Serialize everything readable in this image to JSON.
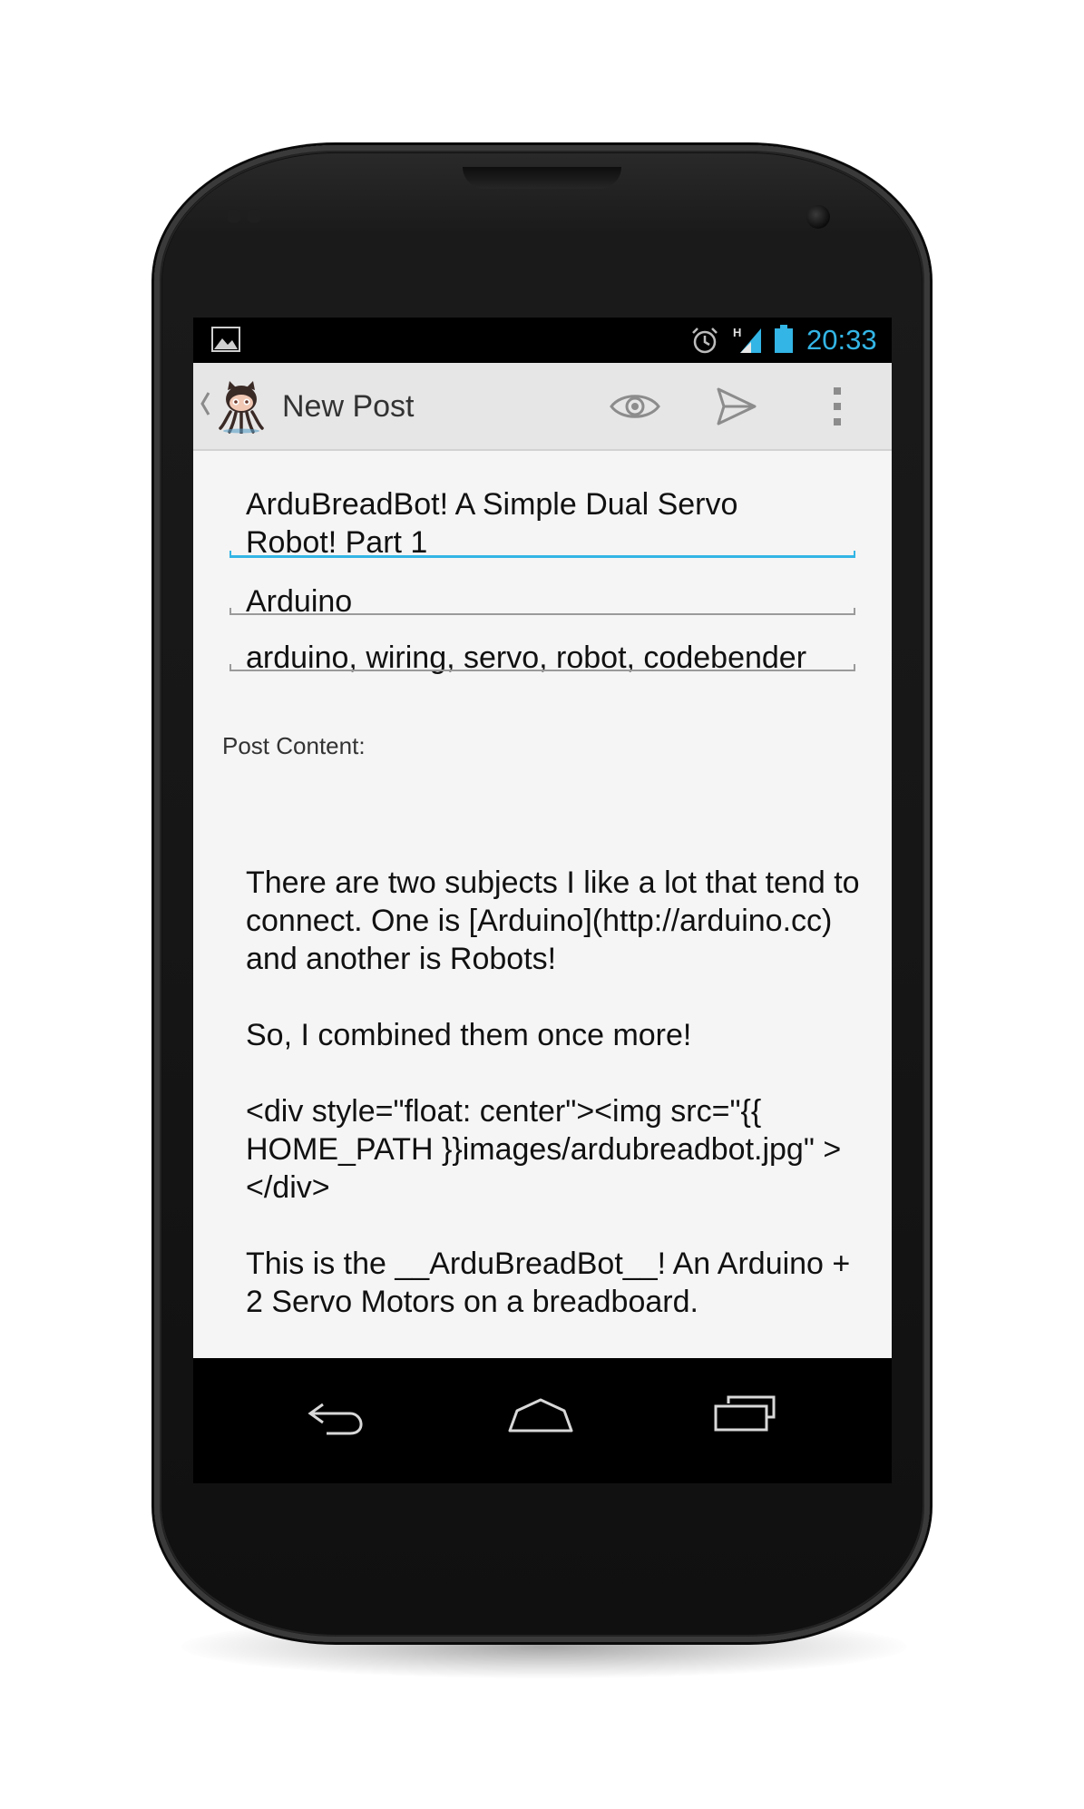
{
  "status_bar": {
    "time": "20:33",
    "network_label": "H",
    "icons": [
      "picture-notification-icon",
      "alarm-icon",
      "signal-icon",
      "battery-icon"
    ],
    "accent_color": "#33b5e5"
  },
  "action_bar": {
    "title": "New Post",
    "actions": [
      "preview-eye-icon",
      "send-icon",
      "overflow-menu-icon"
    ]
  },
  "form": {
    "title_value": "ArduBreadBot! A Simple Dual Servo Robot! Part 1",
    "category_value": "Arduino",
    "tags_value": "arduino, wiring, servo, robot, codebender",
    "content_label": "Post Content:",
    "content_paragraphs": [
      "There are two subjects I like a lot that tend to connect. One is [Arduino](http://arduino.cc) and another is Robots!",
      "So, I combined them once  more!",
      "<div style=\"float: center\"><img src=\"{{ HOME_PATH }}images/ardubreadbot.jpg\" ></div>",
      "This is the __ArduBreadBot__! An Arduino + 2 Servo Motors on a breadboard."
    ]
  },
  "nav_bar": {
    "buttons": [
      "back-icon",
      "home-icon",
      "recent-apps-icon"
    ]
  }
}
